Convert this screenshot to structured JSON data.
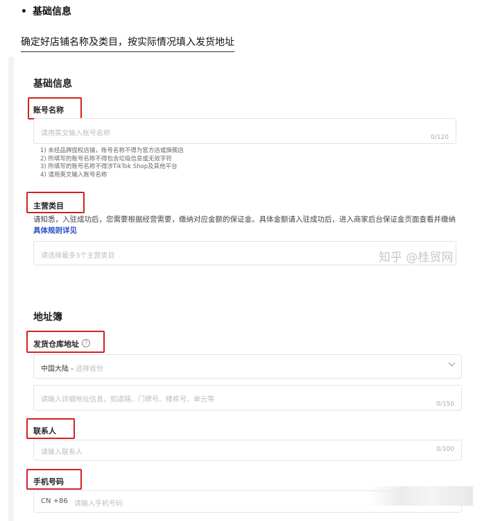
{
  "header": {
    "bullet_title": "基础信息"
  },
  "intro": {
    "text": "确定好店铺名称及类目，按实际情况填入发货地址"
  },
  "form": {
    "basic_section_title": "基础信息",
    "account_name": {
      "label": "账号名称",
      "placeholder": "请用英文输入账号名称",
      "counter": "0/120",
      "hints": [
        "1) 未经品牌授权店铺，账号名称不得为官方店或旗舰店",
        "2) 所填写的账号名称不得包含垃圾信息或无效字符",
        "3) 所填写的账号名称不得涉TikTok Shop及其他平台",
        "4) 请用英文输入账号名称"
      ]
    },
    "category": {
      "label": "主营类目",
      "notice": "请知悉，入驻成功后，您需要根据经营需要，缴纳对应金额的保证金。具体金额请入驻成功后，进入商家后台保证金页面查看并缴纳",
      "notice_link": "具体规则详见",
      "placeholder": "请选择最多3个主营类目"
    },
    "watermark": "知乎 @桂贸网",
    "address_section_title": "地址簿",
    "warehouse": {
      "label": "发货仓库地址",
      "help_icon": "?",
      "region_value": "中国大陆 - ",
      "region_placeholder": "选择省份",
      "detail_placeholder": "请输入详细地址信息，如道路、门牌号、楼栋号、单元等",
      "detail_counter": "0/150"
    },
    "contact": {
      "label": "联系人",
      "placeholder": "请输入联系人",
      "counter": "0/100"
    },
    "phone": {
      "label": "手机号码",
      "prefix": "CN +86",
      "placeholder": "请输入手机号码"
    }
  },
  "colors": {
    "highlight_red": "#d42020",
    "link_blue": "#2a4fc4"
  }
}
